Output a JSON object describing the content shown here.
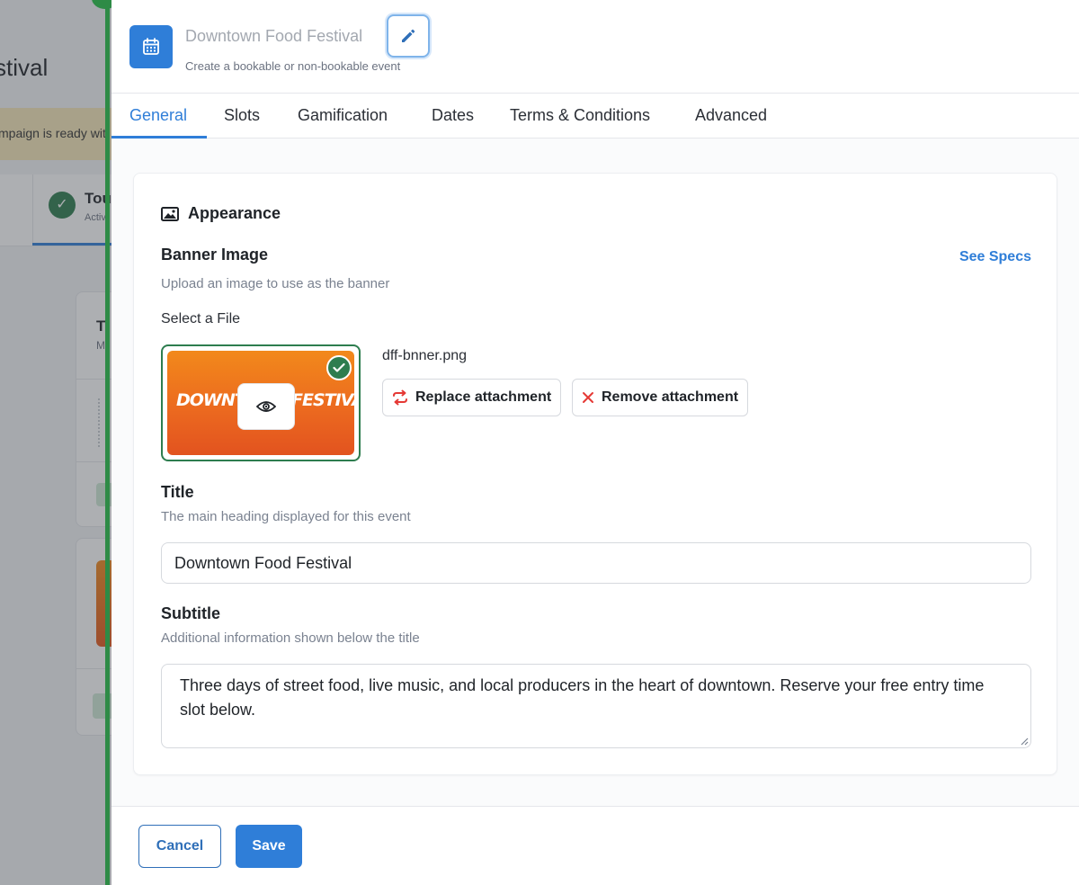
{
  "background": {
    "title_fragment": "stival",
    "banner_fragment": "mpaign is ready wit",
    "step_label_fragment": "Tou",
    "step_sub_fragment": "Activ",
    "card_title_fragment": "T",
    "card_sub_fragment": "M"
  },
  "header": {
    "title": "Downtown Food Festival",
    "subtitle": "Create a bookable or non-bookable event",
    "icon": "calendar-icon",
    "edit_icon": "pencil-icon"
  },
  "tabs": [
    {
      "label": "General",
      "active": true
    },
    {
      "label": "Slots",
      "active": false
    },
    {
      "label": "Gamification",
      "active": false
    },
    {
      "label": "Dates",
      "active": false
    },
    {
      "label": "Terms & Conditions",
      "active": false
    },
    {
      "label": "Advanced",
      "active": false
    }
  ],
  "appearance": {
    "section_title": "Appearance",
    "banner_label": "Banner Image",
    "banner_hint": "Upload an image to use as the banner",
    "see_specs": "See Specs",
    "select_file_label": "Select a File",
    "thumbnail_text_left": "DOWNTO",
    "thumbnail_text_right": "FESTIVAL",
    "file_name": "dff-bnner.png",
    "replace_label": "Replace attachment",
    "remove_label": "Remove attachment"
  },
  "title_field": {
    "label": "Title",
    "hint": "The main heading displayed for this event",
    "value": "Downtown Food Festival"
  },
  "subtitle_field": {
    "label": "Subtitle",
    "hint": "Additional information shown below the title",
    "value": "Three days of street food, live music, and local producers in the heart of downtown. Reserve your free entry time slot below."
  },
  "footer": {
    "cancel_label": "Cancel",
    "save_label": "Save"
  },
  "colors": {
    "accent": "#2f7ed8",
    "success": "#2e7d4f",
    "danger": "#e53935"
  }
}
